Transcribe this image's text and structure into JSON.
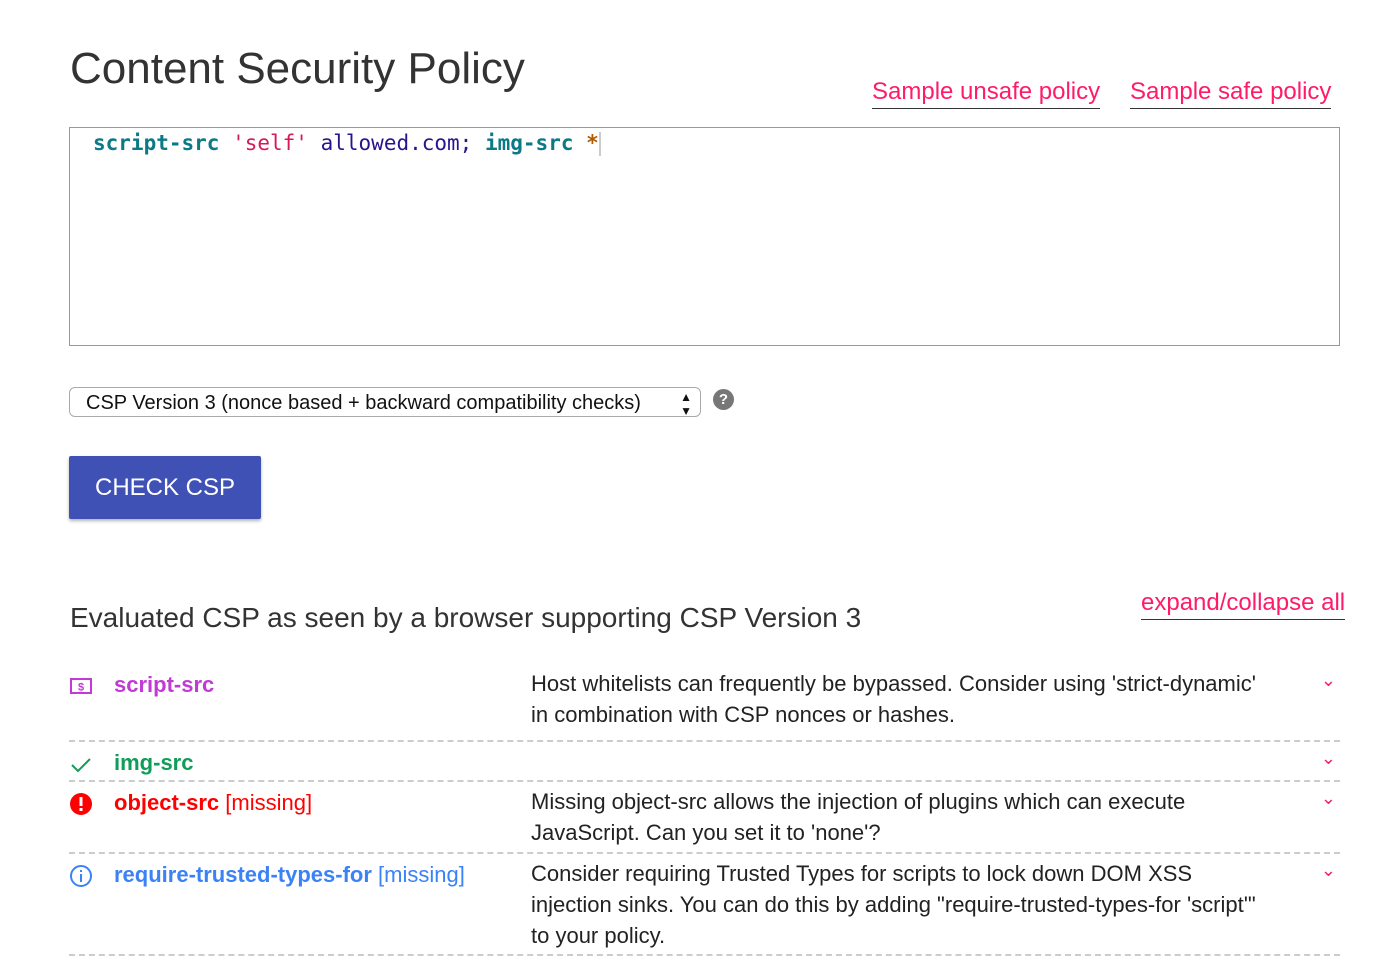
{
  "title": "Content Security Policy",
  "links": {
    "unsafe": "Sample unsafe policy",
    "safe": "Sample safe policy",
    "expand": "expand/collapse all"
  },
  "editor": {
    "tokens": [
      {
        "t": "script-src",
        "c": "kw"
      },
      {
        "t": " "
      },
      {
        "t": "'self'",
        "c": "str"
      },
      {
        "t": " "
      },
      {
        "t": "allowed.com;",
        "c": "host"
      },
      {
        "t": " "
      },
      {
        "t": "img-src",
        "c": "kw"
      },
      {
        "t": " "
      },
      {
        "t": "*",
        "c": "star"
      }
    ]
  },
  "version_select": {
    "value": "CSP Version 3 (nonce based + backward compatibility checks)"
  },
  "help_icon": "?",
  "check_button": "CHECK CSP",
  "results_heading": "Evaluated CSP as seen by a browser supporting CSP Version 3",
  "results": [
    {
      "icon": "dollar-box-icon",
      "color": "#c13ad6",
      "name": "script-src",
      "suffix": "",
      "desc": "Host whitelists can frequently be bypassed. Consider using 'strict-dynamic' in combination with CSP nonces or hashes."
    },
    {
      "icon": "check-icon",
      "color": "#0f9d58",
      "name": "img-src",
      "suffix": "",
      "desc": ""
    },
    {
      "icon": "error-icon",
      "color": "#ff0000",
      "name": "object-src",
      "suffix": "[missing]",
      "desc": "Missing object-src allows the injection of plugins which can execute JavaScript. Can you set it to 'none'?"
    },
    {
      "icon": "info-icon",
      "color": "#3b82f6",
      "name": "require-trusted-types-for",
      "suffix": "[missing]",
      "desc": "Consider requiring Trusted Types for scripts to lock down DOM XSS injection sinks. You can do this by adding \"require-trusted-types-for 'script'\" to your policy."
    }
  ]
}
